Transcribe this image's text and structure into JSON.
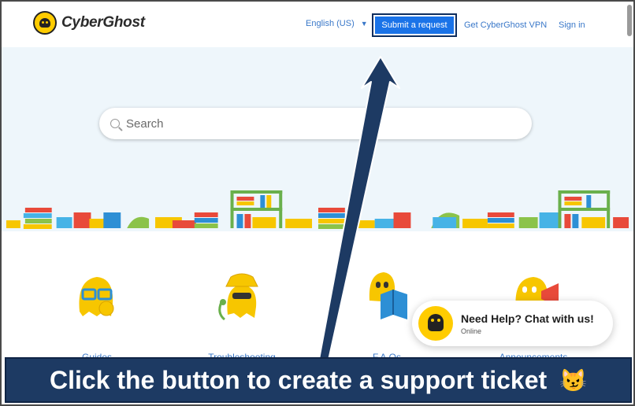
{
  "brand": {
    "name": "CyberGhost"
  },
  "header": {
    "language": "English (US)",
    "submit_label": "Submit a request",
    "get_vpn_label": "Get CyberGhost VPN",
    "signin_label": "Sign in"
  },
  "search": {
    "placeholder": "Search"
  },
  "categories": [
    {
      "label": "Guides",
      "icon": "ghost-glasses-thumbs-up-icon"
    },
    {
      "label": "Troubleshooting",
      "icon": "ghost-detective-icon"
    },
    {
      "label": "F.A.Qs",
      "icon": "ghost-book-icon"
    },
    {
      "label": "Announcements",
      "icon": "ghost-megaphone-icon"
    }
  ],
  "chat": {
    "title": "Need Help? Chat with us!",
    "status": "Online"
  },
  "banner": {
    "text": "Click the button to create a support ticket",
    "emoji": "😼"
  },
  "colors": {
    "accent": "#1a73e8",
    "link": "#3a78c9",
    "brand_yellow": "#ffcc00",
    "hero_bg": "#eef6fb",
    "banner_bg": "#1d3a63"
  }
}
